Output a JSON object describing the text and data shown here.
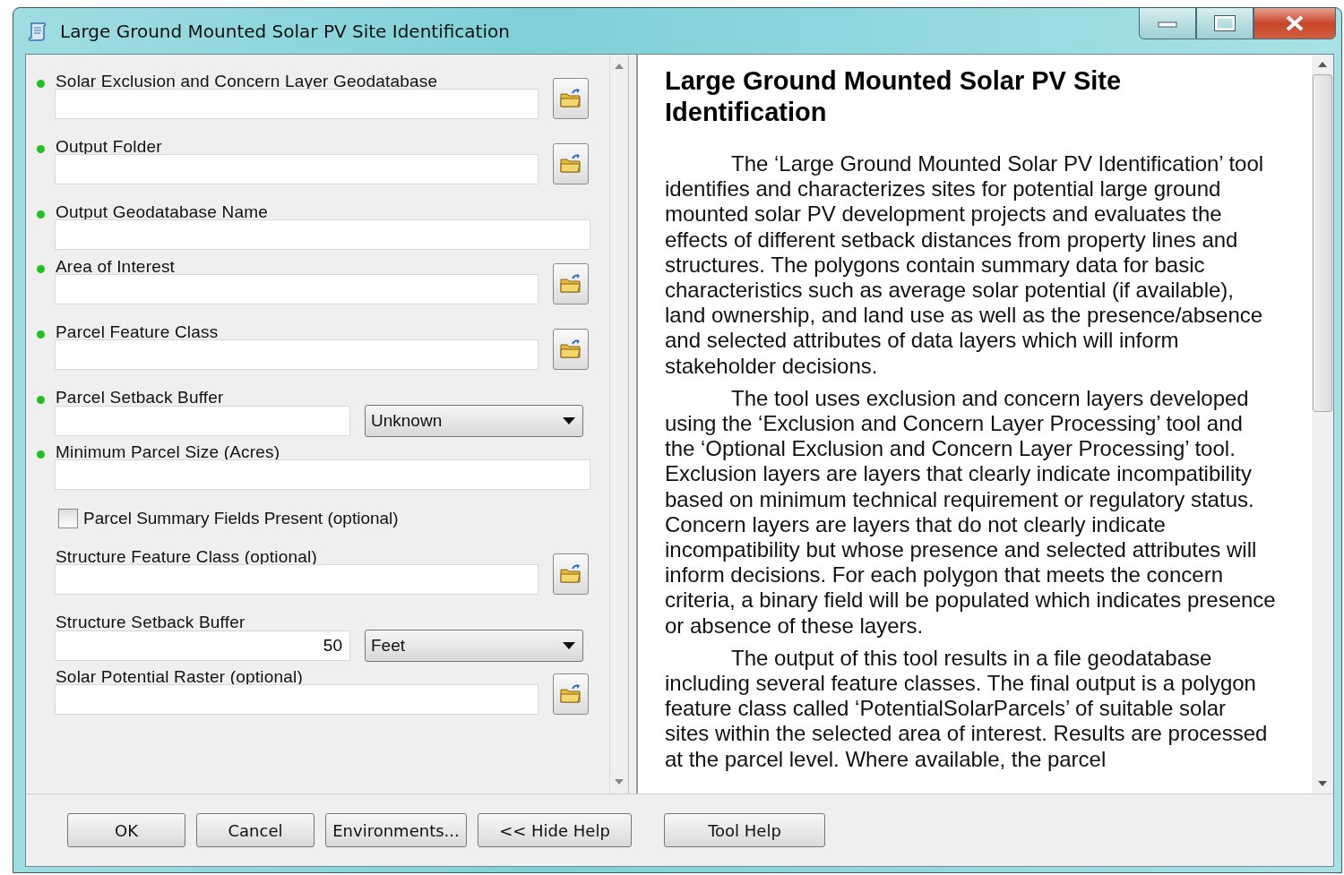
{
  "window": {
    "title": "Large Ground Mounted Solar PV Site Identification"
  },
  "params": [
    {
      "kind": "path",
      "label": "Solar Exclusion and Concern Layer Geodatabase",
      "required": true
    },
    {
      "kind": "path",
      "label": "Output Folder",
      "required": true
    },
    {
      "kind": "text",
      "label": "Output Geodatabase Name",
      "required": true
    },
    {
      "kind": "path",
      "label": "Area of Interest",
      "required": true
    },
    {
      "kind": "path",
      "label": "Parcel Feature Class",
      "required": true
    },
    {
      "kind": "unit",
      "label": "Parcel Setback Buffer",
      "required": true,
      "unit": "Unknown"
    },
    {
      "kind": "text",
      "label": "Minimum Parcel Size (Acres)",
      "required": true
    },
    {
      "kind": "checkbox",
      "label": "Parcel Summary Fields Present (optional)",
      "checked": false
    },
    {
      "kind": "path",
      "label": "Structure Feature Class (optional)",
      "required": false
    },
    {
      "kind": "unit",
      "label": "Structure Setback Buffer",
      "required": false,
      "value": "50",
      "unit": "Feet"
    },
    {
      "kind": "path",
      "label": "Solar Potential Raster (optional)",
      "required": false
    }
  ],
  "help": {
    "heading": "Large Ground Mounted Solar PV Site Identification",
    "paragraphs": [
      "The ‘Large Ground Mounted Solar PV Identification’ tool identifies and characterizes sites for potential large ground mounted solar PV development projects and evaluates the effects of different setback distances from property lines and structures. The polygons contain summary data for basic characteristics such as average solar potential (if available), land ownership, and land use as well as the presence/absence and selected attributes of data layers which will inform stakeholder decisions.",
      "The tool uses exclusion and concern layers developed using the ‘Exclusion and Concern Layer Processing’ tool and the ‘Optional Exclusion and Concern Layer Processing’ tool. Exclusion layers are layers that clearly indicate incompatibility based on minimum technical requirement or regulatory status. Concern layers are layers that do not clearly indicate incompatibility but whose presence and selected attributes will inform decisions. For each polygon that meets the concern criteria, a binary field will be populated which indicates presence or absence of these layers.",
      "The output of this tool results in a file geodatabase including several feature classes. The final output is a polygon feature class called ‘PotentialSolarParcels’ of suitable solar sites within the selected area of interest. Results are processed at the parcel level. Where available, the parcel"
    ]
  },
  "buttons": [
    "OK",
    "Cancel",
    "Environments...",
    "<< Hide Help"
  ],
  "tool_help_button": "Tool Help"
}
